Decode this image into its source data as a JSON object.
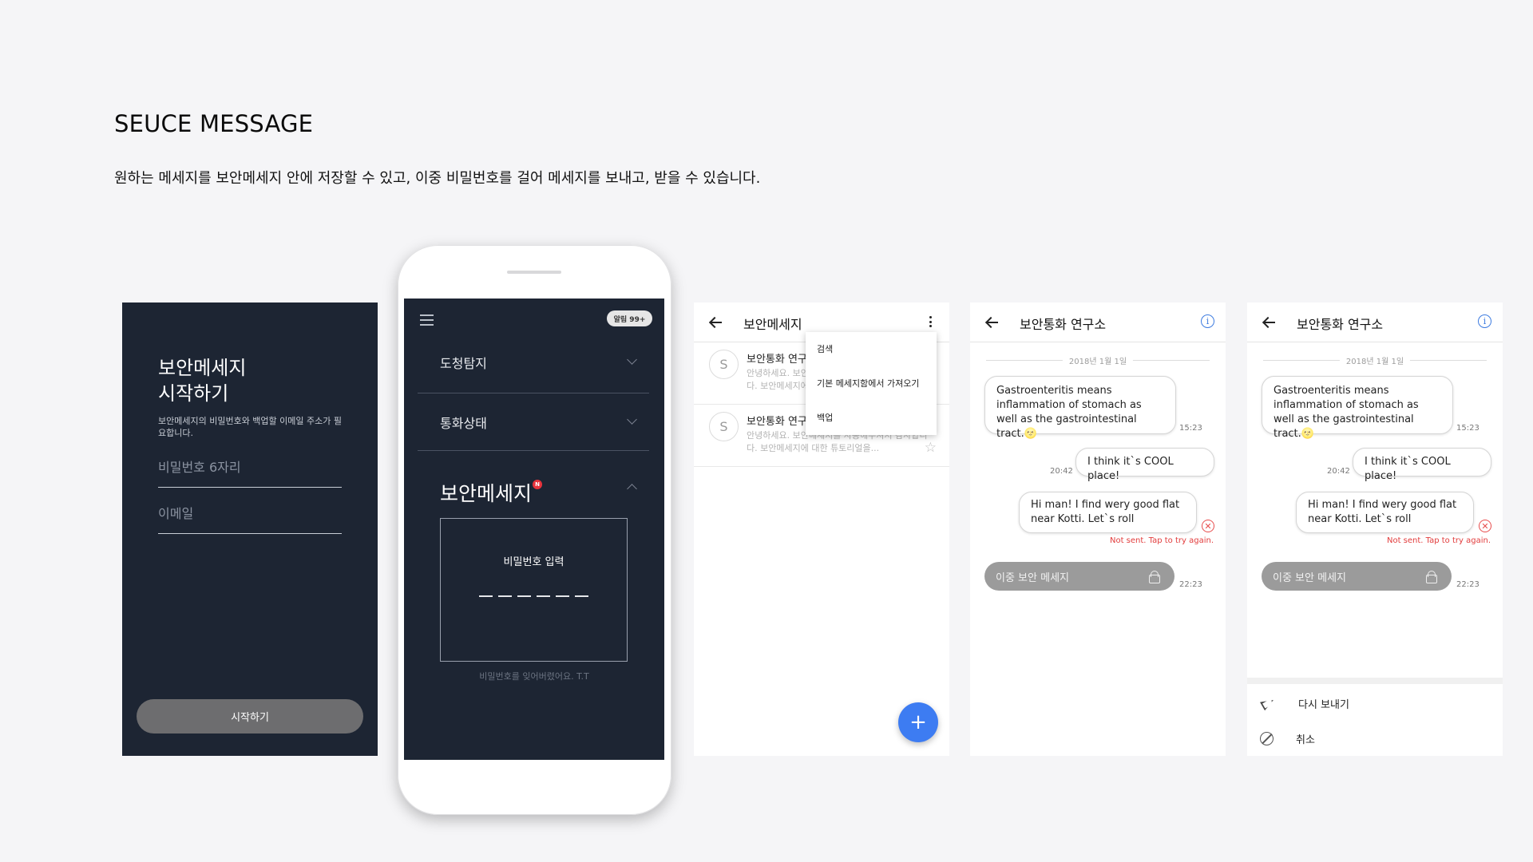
{
  "header": {
    "title": "SEUCE MESSAGE",
    "subtitle": "원하는 메세지를 보안메세지 안에 저장할 수 있고, 이중 비밀번호를 걸어 메세지를 보내고, 받을 수 있습니다."
  },
  "screen_start": {
    "heading": "보안메세지\n시작하기",
    "description": "보안메세지의 비밀번호와 백업할 이메일 주소가 필요합니다.",
    "password_placeholder": "비밀번호 6자리",
    "email_placeholder": "이메일",
    "start_button": "시작하기"
  },
  "screen_phone": {
    "notification_badge": "알림 99+",
    "menu": [
      {
        "label": "도청탐지",
        "expanded": false
      },
      {
        "label": "통화상태",
        "expanded": false
      },
      {
        "label": "보안메세지",
        "expanded": true,
        "badge": "N"
      }
    ],
    "password_prompt": "비밀번호 입력",
    "password_length": 6,
    "forgot_text": "비밀번호를 잊어버렸어요. T.T"
  },
  "screen_list": {
    "title": "보안메세지",
    "items": [
      {
        "avatar": "S",
        "name": "보안통화 연구소",
        "preview": "안녕하세요. 보안메세지를 사용해주셔서 감사합니다. 보안메세지에 대한 튜토리얼을..."
      },
      {
        "avatar": "S",
        "name": "보안통화 연구소",
        "preview": "안녕하세요. 보안메세지를 사용해주셔서 감사합니다. 보안메세지에 대한 튜토리얼을..."
      }
    ],
    "menu_items": [
      "검색",
      "기본 메세지함에서 가져오기",
      "백업"
    ],
    "fab_label": "+"
  },
  "screen_chat": {
    "title": "보안통화 연구소",
    "date": "2018년 1월 1일",
    "messages": [
      {
        "text": "Gastroenteritis means inflammation of stomach as well as the gastrointestinal tract.🌝",
        "time": "15:23",
        "side": "left"
      },
      {
        "text": "I think it`s COOL place!",
        "time": "20:42",
        "side": "right"
      },
      {
        "text": "Hi man! I find wery good flat near Kotti. Let`s roll",
        "time": "",
        "side": "right",
        "status": "Not sent. Tap to try again."
      }
    ],
    "secure_message": {
      "label": "이중 보안 메세지",
      "time": "22:23"
    }
  },
  "screen_chat_actions": {
    "resend": "다시 보내기",
    "cancel": "취소"
  },
  "colors": {
    "dark_bg": "#1d2533",
    "accent_blue": "#3d7cf2",
    "error_red": "#e23c3c",
    "button_gray": "#6d6d6f"
  }
}
